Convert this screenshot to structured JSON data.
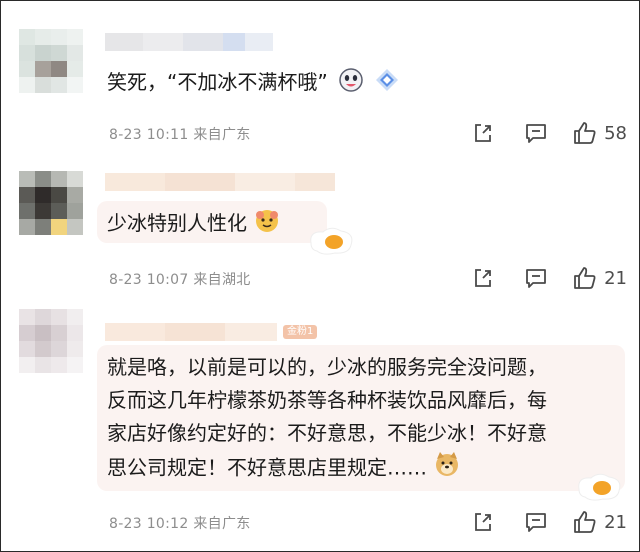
{
  "comments": [
    {
      "text": "笑死，“不加冰不满杯哦”",
      "date": "8-23 10:11",
      "location": "来自广东",
      "likes": "58"
    },
    {
      "text": "少冰特别人性化",
      "date": "8-23 10:07",
      "location": "来自湖北",
      "likes": "21"
    },
    {
      "badge": "金粉1",
      "lines": [
        "就是咯，以前是可以的，少冰的服务完全没问题，",
        "反而这几年柠檬茶奶茶等各种杯装饮品风靡后，每",
        "家店好像约定好的：不好意思，不能少冰！不好意",
        "思公司规定！不好意思店里规定……"
      ],
      "date": "8-23 10:12",
      "location": "来自广东",
      "likes": "21"
    }
  ],
  "icons": {
    "share": "share-icon",
    "comment": "comment-icon",
    "like": "thumbs-up-icon"
  },
  "colors": {
    "bubble": "#fbf3f1",
    "meta": "#8d8d8d",
    "badge": "#f3c3a8"
  }
}
